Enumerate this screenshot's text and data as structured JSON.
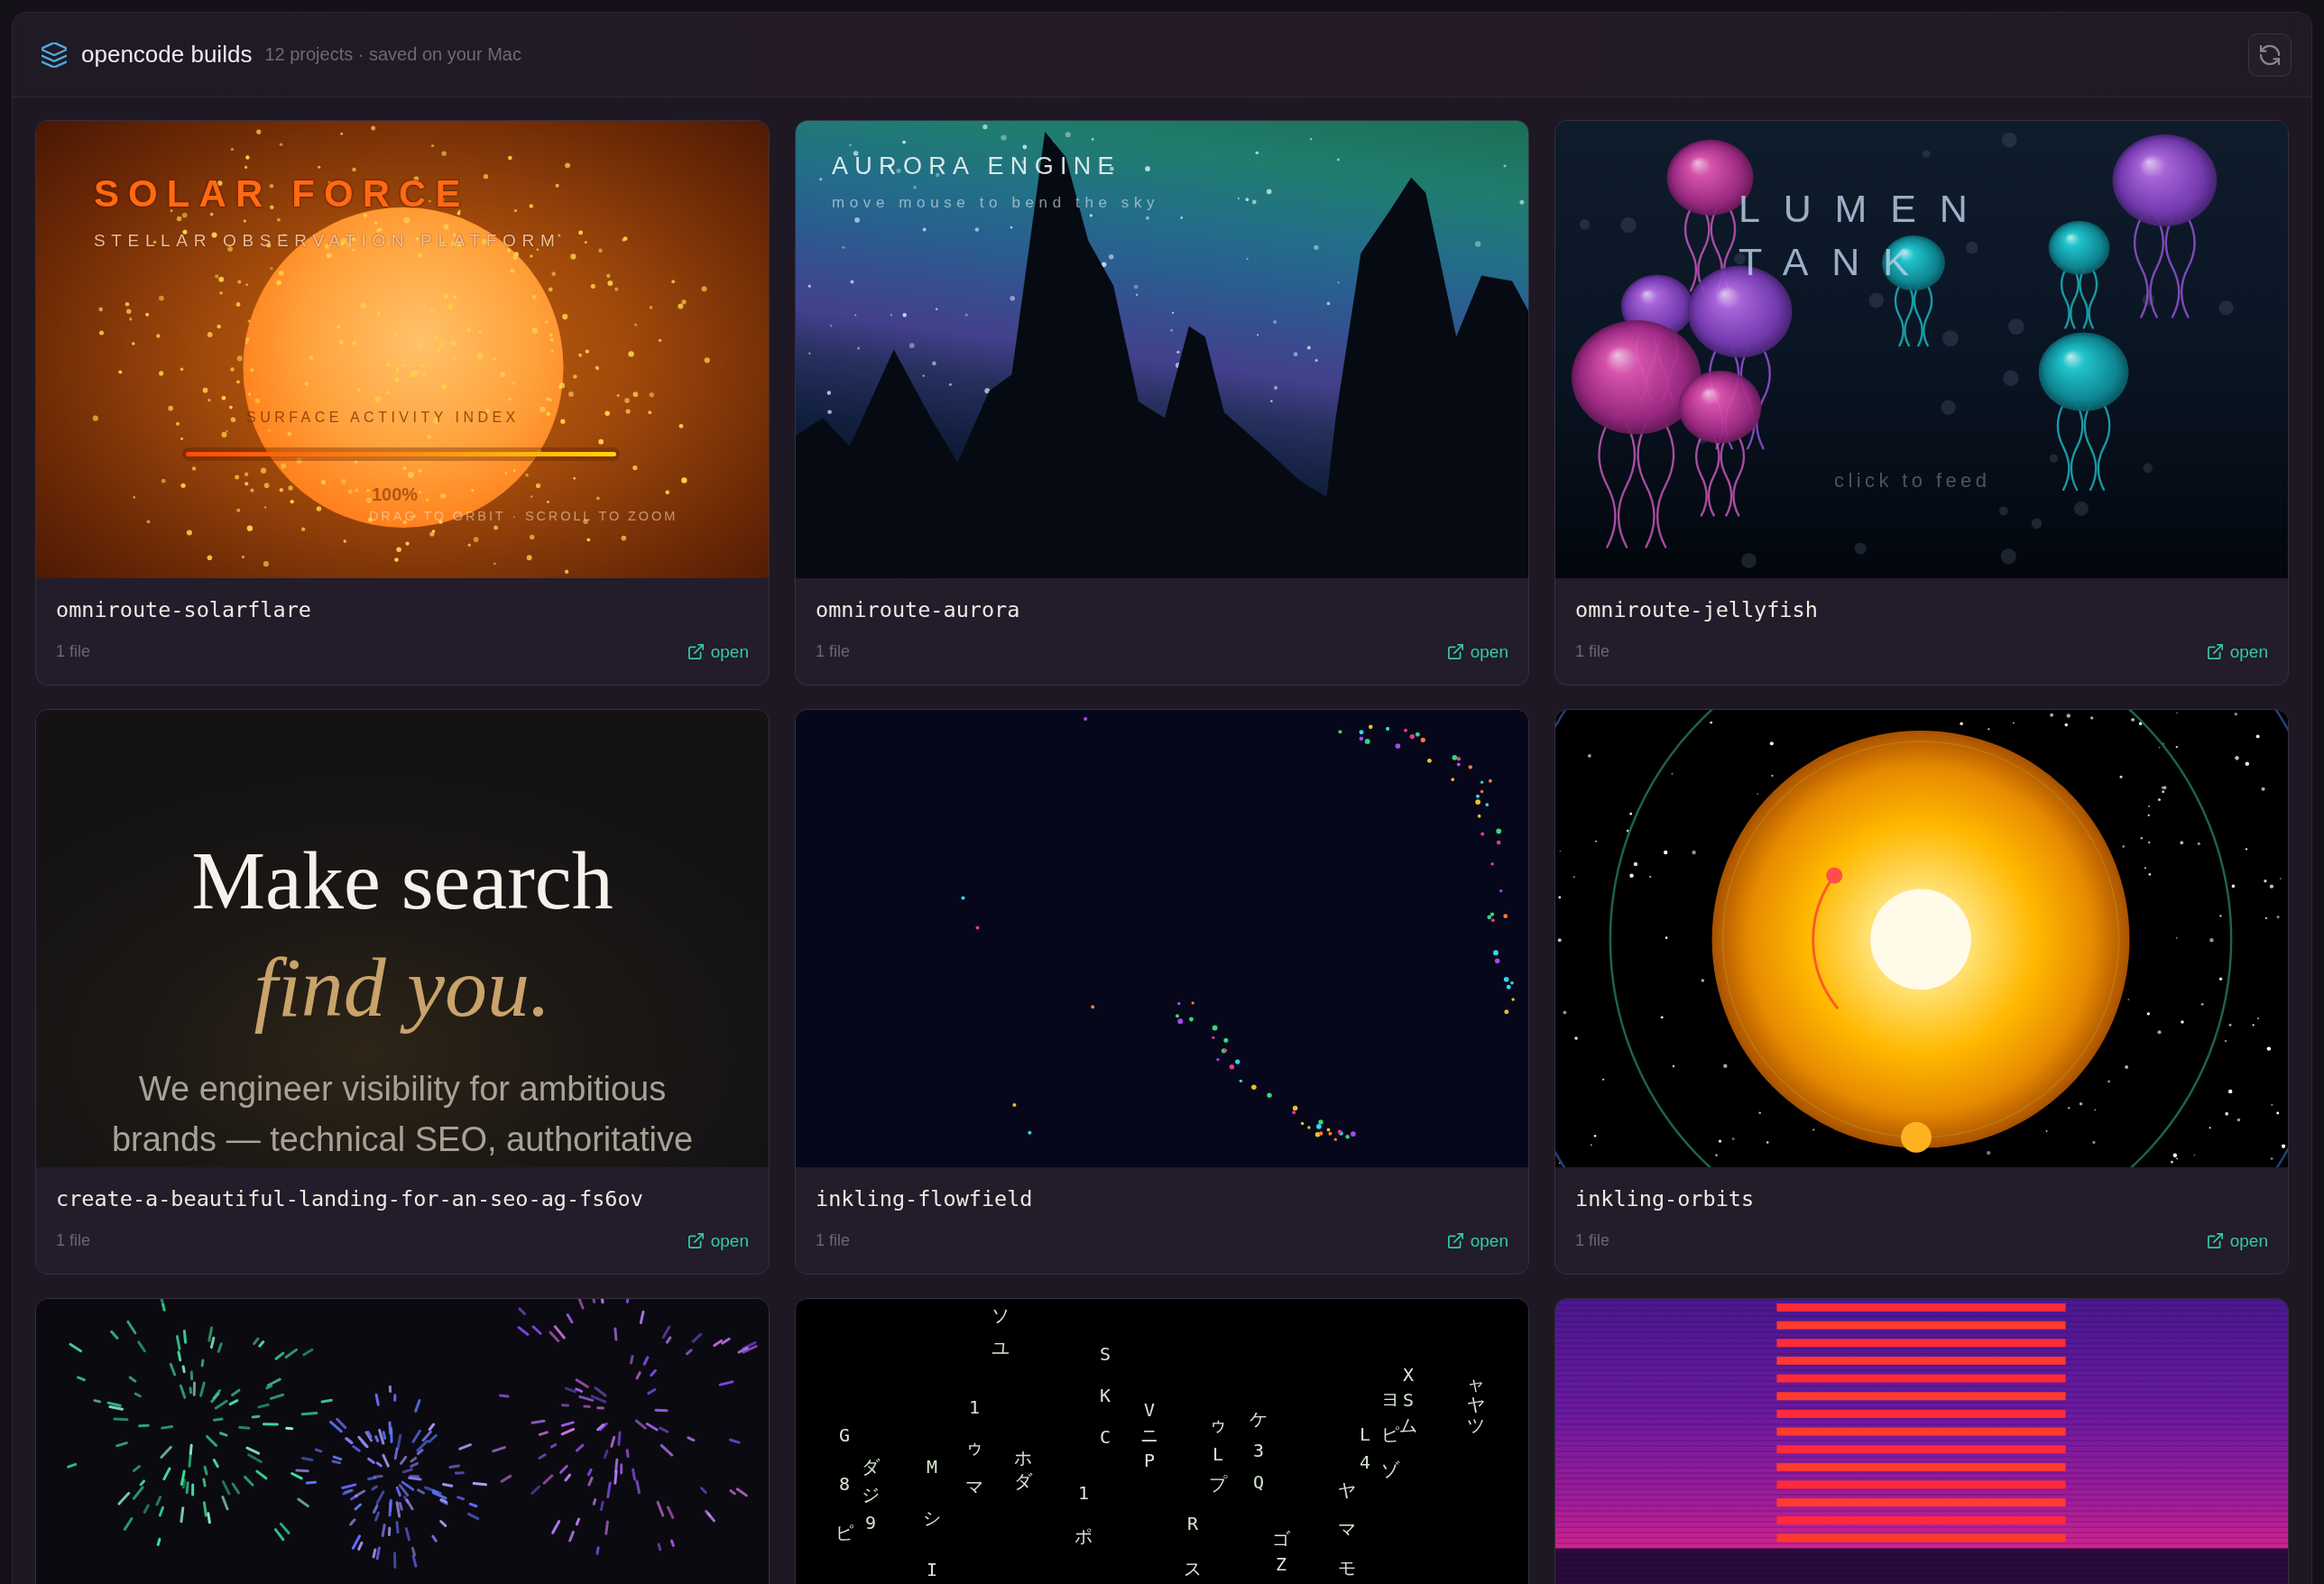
{
  "header": {
    "title": "opencode builds",
    "subtitle": "12 projects · saved on your Mac"
  },
  "projects": [
    {
      "name": "omniroute-solarflare",
      "files": "1 file",
      "action": "open",
      "preview": {
        "kind": "solar",
        "title": "SOLAR FORCE",
        "subtitle": "STELLAR OBSERVATION PLATFORM",
        "meter": {
          "label": "SURFACE ACTIVITY INDEX",
          "level": 1,
          "reading": "100%"
        },
        "hint": "DRAG TO ORBIT · SCROLL TO ZOOM"
      }
    },
    {
      "name": "omniroute-aurora",
      "files": "1 file",
      "action": "open",
      "preview": {
        "kind": "aurora",
        "title": "AURORA ENGINE",
        "hint": "move mouse to bend the sky"
      }
    },
    {
      "name": "omniroute-jellyfish",
      "files": "1 file",
      "action": "open",
      "preview": {
        "kind": "jellyfish",
        "title": "LUMEN TANK",
        "hint": "click to feed"
      }
    },
    {
      "name": "create-a-beautiful-landing-for-an-seo-ag-fs6ov",
      "files": "1 file",
      "action": "open",
      "preview": {
        "kind": "landing",
        "headline": "Make search",
        "headline_accent": "find you.",
        "body": "We engineer visibility for ambitious brands — technical SEO, authoritative"
      }
    },
    {
      "name": "inkling-flowfield",
      "files": "1 file",
      "action": "open",
      "preview": {
        "kind": "flowfield"
      }
    },
    {
      "name": "inkling-orbits",
      "files": "1 file",
      "action": "open",
      "preview": {
        "kind": "orbits"
      }
    },
    {
      "preview": {
        "kind": "fireworks"
      }
    },
    {
      "preview": {
        "kind": "matrix",
        "glyph_columns": [
          "G8ピ",
          "ダジ9",
          "MシI",
          "1ゥマ",
          "ソユ",
          "ホダ",
          "1ポ",
          "SKC",
          "VニP",
          "Rス",
          "ゥLプ",
          "ケ3Q",
          "ゴZ",
          "ヤマモ",
          "L4",
          "ヨピゾ",
          "XSム",
          "ャヤツ"
        ]
      }
    },
    {
      "preview": {
        "kind": "synthwave"
      }
    }
  ]
}
